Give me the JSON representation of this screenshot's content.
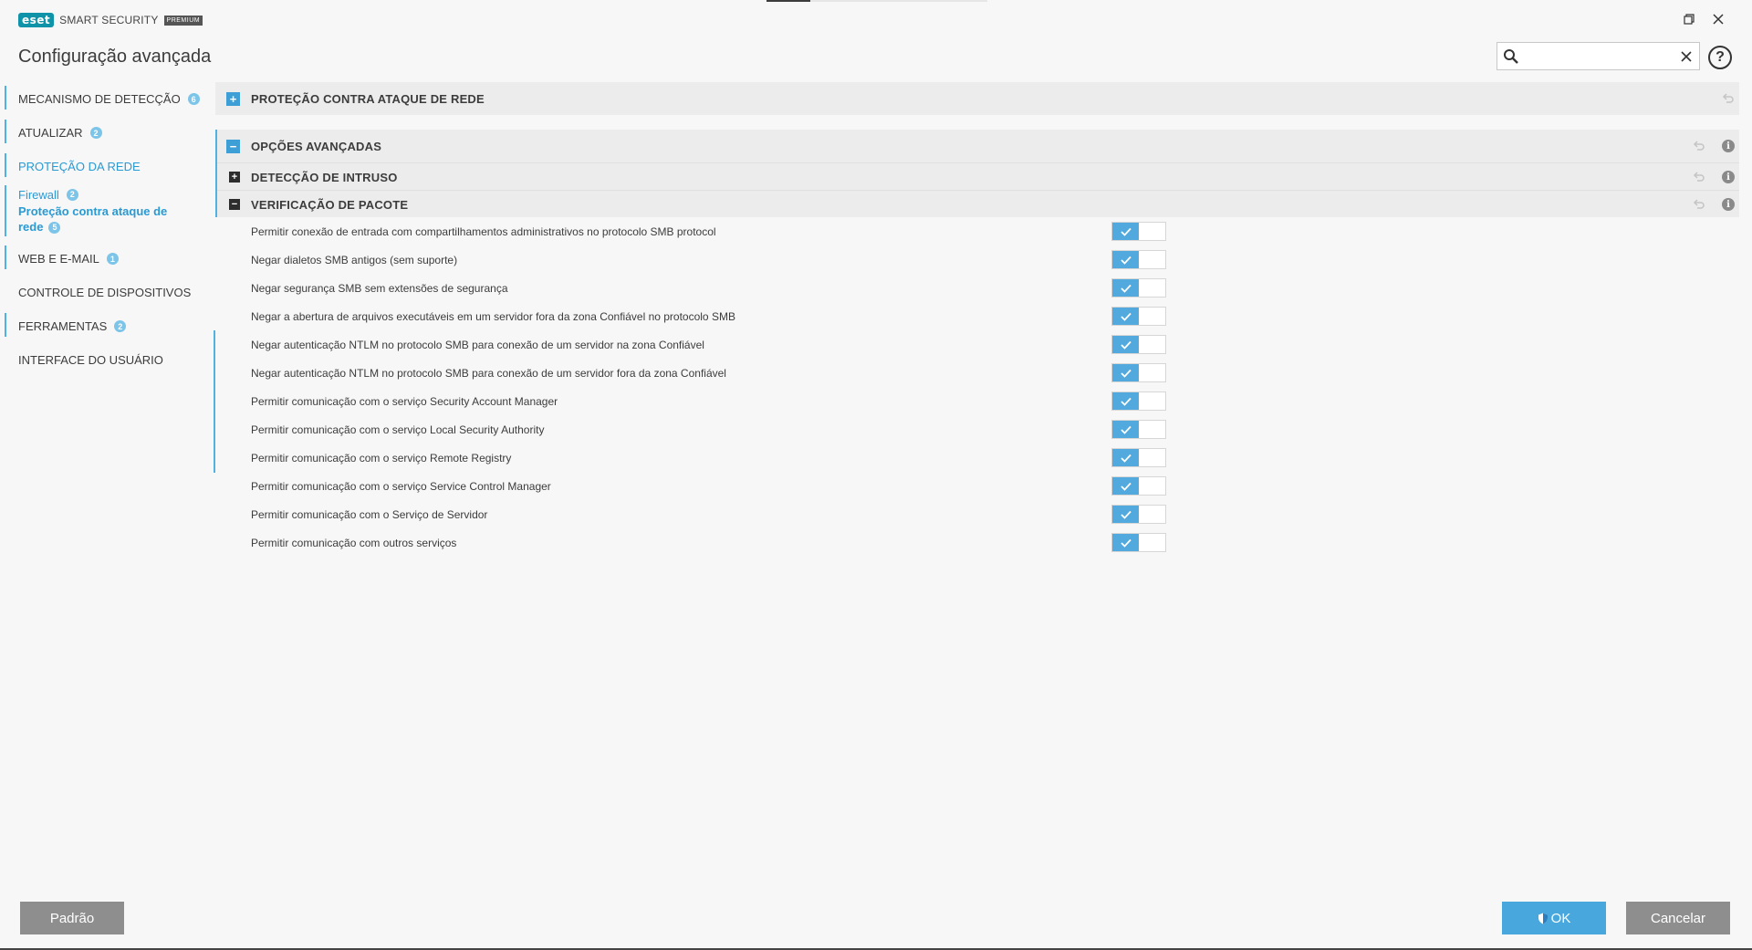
{
  "app": {
    "brand": "eset",
    "product": "SMART SECURITY",
    "edition": "PREMIUM",
    "title": "Configuração avançada"
  },
  "search": {
    "value": "",
    "placeholder": ""
  },
  "sidebar": {
    "items": [
      {
        "label": "MECANISMO DE DETECÇÃO",
        "badge": "6"
      },
      {
        "label": "ATUALIZAR",
        "badge": "2"
      },
      {
        "label": "PROTEÇÃO DA REDE",
        "badge": ""
      },
      {
        "label": "WEB E E-MAIL",
        "badge": "1"
      },
      {
        "label": "CONTROLE DE DISPOSITIVOS",
        "badge": ""
      },
      {
        "label": "FERRAMENTAS",
        "badge": "2"
      },
      {
        "label": "INTERFACE DO USUÁRIO",
        "badge": ""
      }
    ],
    "subitems": [
      {
        "label": "Firewall",
        "badge": "2"
      },
      {
        "label": "Proteção contra ataque de rede",
        "badge": "5"
      }
    ]
  },
  "sections": {
    "network_attack": {
      "title": "PROTEÇÃO CONTRA ATAQUE DE REDE",
      "toggle": "+"
    },
    "advanced": {
      "title": "OPÇÕES AVANÇADAS",
      "toggle": "−"
    },
    "intrusion": {
      "title": "DETECÇÃO DE INTRUSO",
      "toggle": "+"
    },
    "packet": {
      "title": "VERIFICAÇÃO DE PACOTE",
      "toggle": "−"
    }
  },
  "options": [
    {
      "label": "Permitir conexão de entrada com compartilhamentos administrativos no protocolo SMB protocol",
      "enabled": true
    },
    {
      "label": "Negar dialetos SMB antigos (sem suporte)",
      "enabled": true
    },
    {
      "label": "Negar segurança SMB sem extensões de segurança",
      "enabled": true
    },
    {
      "label": "Negar a abertura de arquivos executáveis em um servidor fora da zona Confiável no protocolo SMB",
      "enabled": true
    },
    {
      "label": "Negar autenticação NTLM no protocolo SMB para conexão de um servidor na zona Confiável",
      "enabled": true
    },
    {
      "label": "Negar autenticação NTLM no protocolo SMB para conexão de um servidor fora da zona Confiável",
      "enabled": true
    },
    {
      "label": "Permitir comunicação com o serviço Security Account Manager",
      "enabled": true
    },
    {
      "label": "Permitir comunicação com o serviço Local Security Authority",
      "enabled": true
    },
    {
      "label": "Permitir comunicação com o serviço Remote Registry",
      "enabled": true
    },
    {
      "label": "Permitir comunicação com o serviço Service Control Manager",
      "enabled": true
    },
    {
      "label": "Permitir comunicação com o Serviço de Servidor",
      "enabled": true
    },
    {
      "label": "Permitir comunicação com outros serviços",
      "enabled": true
    }
  ],
  "footer": {
    "default_label": "Padrão",
    "ok_label": "OK",
    "cancel_label": "Cancelar"
  },
  "colors": {
    "accent": "#48a7dd",
    "brand": "#0f93a8",
    "toggle_on": "#51a9de",
    "button_gray": "#8e8e8e"
  },
  "icons": {
    "restore": "restore-window-icon",
    "close": "close-icon",
    "search": "search-icon",
    "clear": "clear-search-icon",
    "help": "help-icon",
    "revert": "revert-icon",
    "info": "info-icon",
    "check": "checkmark-icon",
    "shield": "shield-icon"
  }
}
